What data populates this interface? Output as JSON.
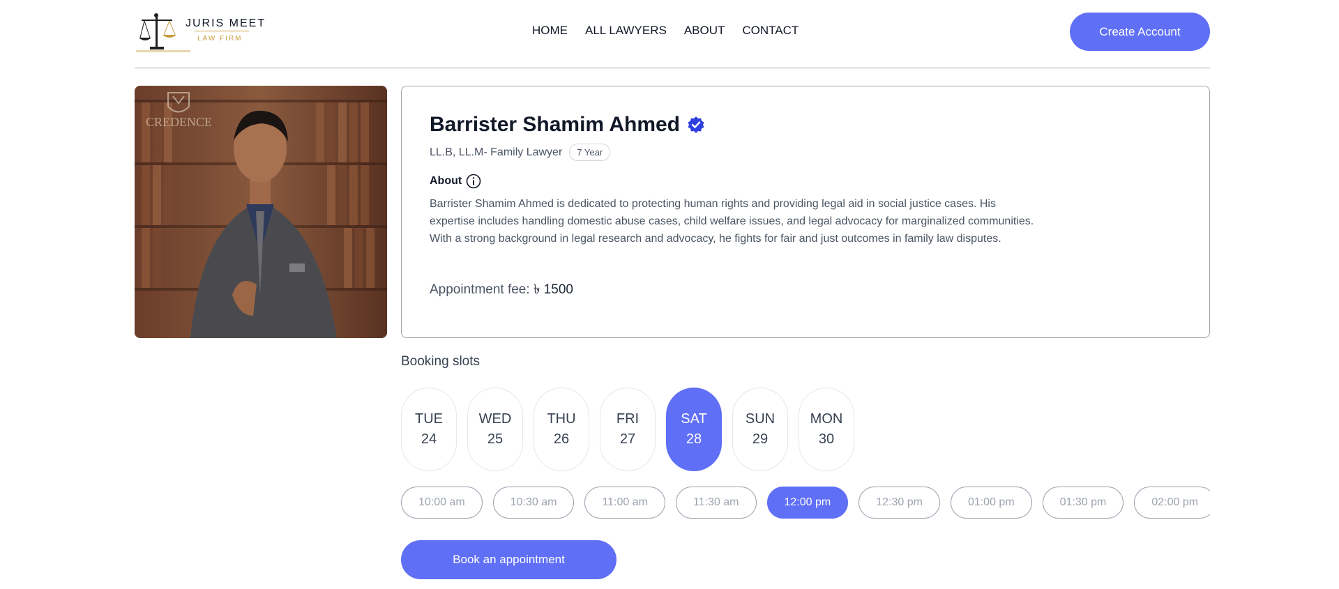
{
  "brand": {
    "name": "JURIS MEET",
    "tagline": "LAW FIRM"
  },
  "nav": {
    "items": [
      "HOME",
      "ALL LAWYERS",
      "ABOUT",
      "CONTACT"
    ]
  },
  "header": {
    "create_account_label": "Create Account"
  },
  "lawyer": {
    "name": "Barrister Shamim Ahmed",
    "degree": "LL.B, LL.M- Family Lawyer",
    "experience": "7 Year",
    "about_label": "About",
    "about_text": "Barrister Shamim Ahmed is dedicated to protecting human rights and providing legal aid in social justice cases. His expertise includes handling domestic abuse cases, child welfare issues, and legal advocacy for marginalized communities. With a strong background in legal research and advocacy, he fights for fair and just outcomes in family law disputes.",
    "fee_label": "Appointment fee:",
    "fee_value": "৳ 1500",
    "photo_watermark": "CREDENCE"
  },
  "booking": {
    "title": "Booking slots",
    "days": [
      {
        "name": "TUE",
        "num": "24",
        "active": false
      },
      {
        "name": "WED",
        "num": "25",
        "active": false
      },
      {
        "name": "THU",
        "num": "26",
        "active": false
      },
      {
        "name": "FRI",
        "num": "27",
        "active": false
      },
      {
        "name": "SAT",
        "num": "28",
        "active": true
      },
      {
        "name": "SUN",
        "num": "29",
        "active": false
      },
      {
        "name": "MON",
        "num": "30",
        "active": false
      }
    ],
    "slots": [
      {
        "time": "10:00 am",
        "active": false
      },
      {
        "time": "10:30 am",
        "active": false
      },
      {
        "time": "11:00 am",
        "active": false
      },
      {
        "time": "11:30 am",
        "active": false
      },
      {
        "time": "12:00 pm",
        "active": true
      },
      {
        "time": "12:30 pm",
        "active": false
      },
      {
        "time": "01:00 pm",
        "active": false
      },
      {
        "time": "01:30 pm",
        "active": false
      },
      {
        "time": "02:00 pm",
        "active": false
      }
    ],
    "book_label": "Book an appointment"
  },
  "colors": {
    "accent": "#5f6ff6",
    "verified": "#2f3fe0",
    "gold": "#c79a3a"
  }
}
